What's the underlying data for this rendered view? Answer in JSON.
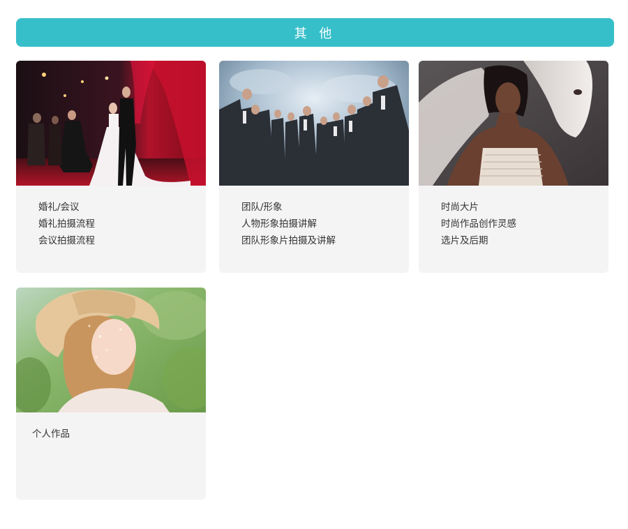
{
  "section": {
    "title": "其 他",
    "accent_color": "#36bfc9"
  },
  "cards": [
    {
      "image_description": "wedding-ceremony-photo",
      "lines": [
        "婚礼/会议",
        "婚礼拍摄流程",
        "会议拍摄流程"
      ]
    },
    {
      "image_description": "team-group-photo",
      "lines": [
        "团队/形象",
        "人物形象拍摄讲解",
        "团队形象片拍摄及讲解"
      ]
    },
    {
      "image_description": "fashion-horse-photo",
      "lines": [
        "时尚大片",
        "时尚作品创作灵感",
        "选片及后期"
      ]
    },
    {
      "image_description": "personal-portrait-photo",
      "lines": [
        "个人作品"
      ]
    }
  ]
}
